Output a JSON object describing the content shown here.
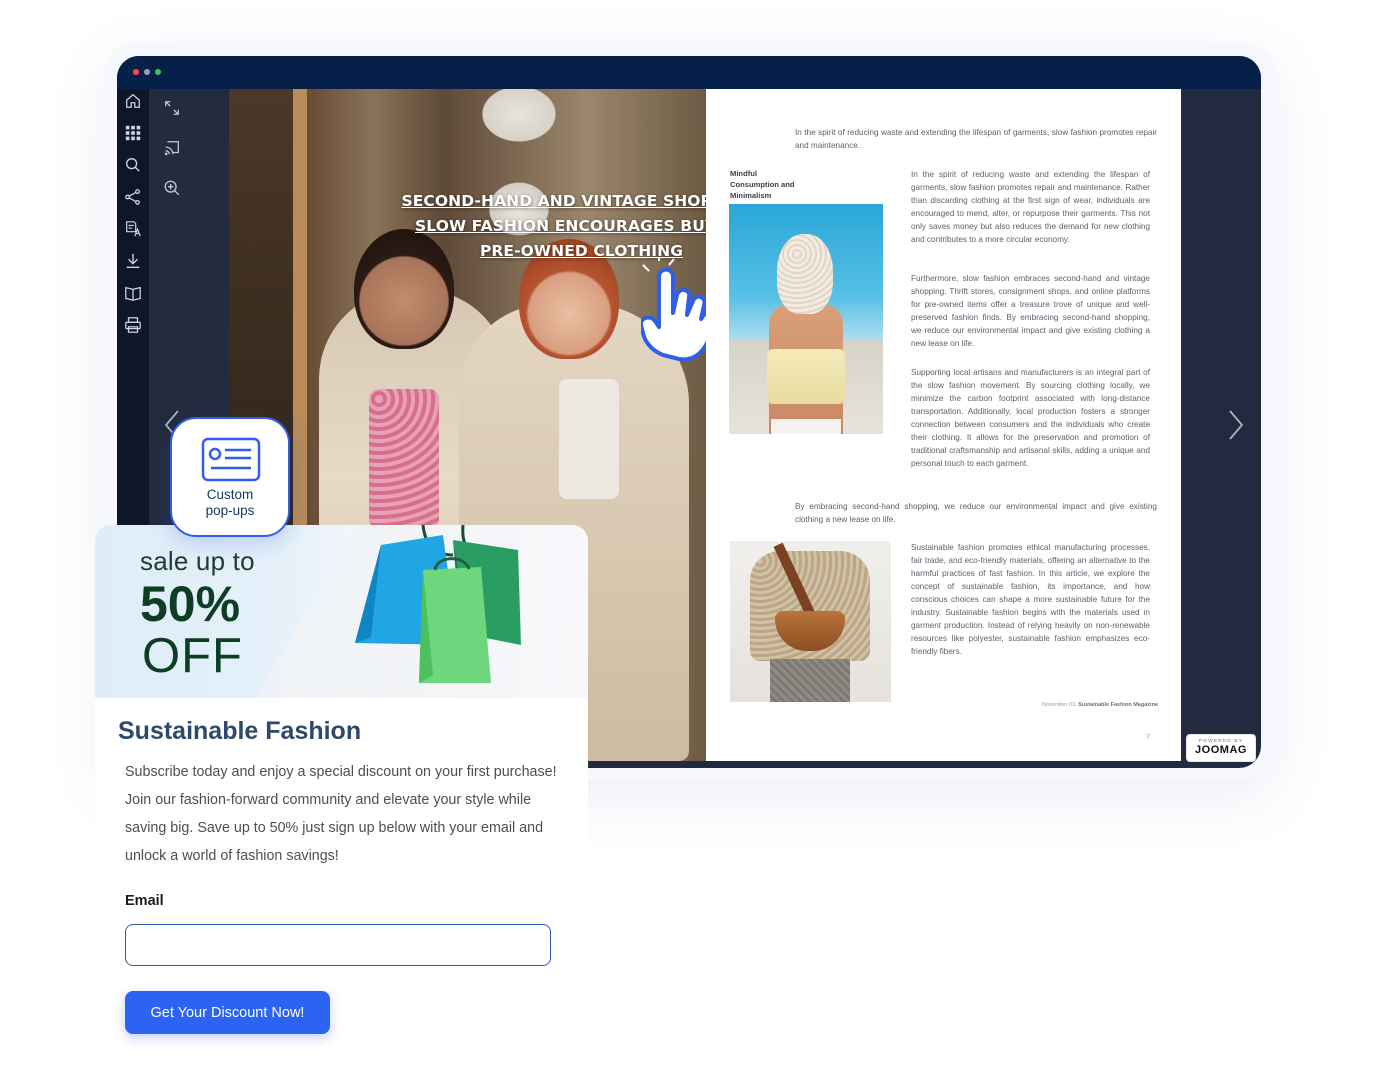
{
  "window": {
    "sidebar_icons": [
      "home-icon",
      "grid-icon",
      "search-icon",
      "share-icon",
      "translate-icon",
      "download-icon",
      "book-icon",
      "print-icon"
    ],
    "tool_icons": [
      "expand-icon",
      "cast-icon",
      "zoom-in-icon"
    ]
  },
  "left_page": {
    "headline_line1": "SECOND-HAND AND VINTAGE SHOPPING:",
    "headline_line2": "SLOW FASHION ENCOURAGES BUYING",
    "headline_line3": "PRE-OWNED CLOTHING"
  },
  "right_page": {
    "intro": "In the spirit of reducing waste and extending the lifespan of garments, slow fashion promotes repair and maintenance.",
    "side_heading_line1": "Mindful",
    "side_heading_line2": "Consumption and",
    "side_heading_line3": "Minimalism",
    "para1": "In the spirit of reducing waste and extending the lifespan of garments, slow fashion promotes repair and maintenance. Rather than discarding clothing at the first sign of wear, individuals are encouraged to mend, alter, or repurpose their garments. This not only saves money but also reduces the demand for new clothing and contributes to a more circular economy.",
    "para2": "Furthermore, slow fashion embraces second-hand and vintage shopping. Thrift stores, consignment shops, and online platforms for pre-owned items offer a treasure trove of unique and well-preserved fashion finds. By embracing second-hand shopping, we reduce our environmental impact and give existing clothing a new lease on life.",
    "para3": "Supporting local artisans and manufacturers is an integral part of the slow fashion movement. By sourcing clothing locally, we minimize the carbon footprint associated with long-distance transportation. Additionally, local production fosters a stronger connection between consumers and the individuals who create their clothing. It allows for the preservation and promotion of traditional craftsmanship and artisanal skills, adding a unique and personal touch to each garment.",
    "mid": "By embracing second-hand shopping, we reduce our environmental impact and give existing clothing a new lease on life.",
    "para4": "Sustainable fashion promotes ethical manufacturing processes, fair trade, and eco-friendly materials, offering an alternative to the harmful practices of fast fashion. In this article, we explore the concept of sustainable fashion, its importance, and how conscious choices can shape a more sustainable future for the industry. Sustainable fashion begins with the materials used in garment production. Instead of relying heavily on non-renewable resources like polyester, sustainable fashion emphasizes eco-friendly fibers.",
    "footer_date": "November 03,",
    "footer_mag": "Sustainable Fashion Magazine",
    "page_number": "7"
  },
  "joomag": {
    "powered_by": "POWERED BY",
    "name": "JOOMAG"
  },
  "badge": {
    "line1": "Custom",
    "line2": "pop-ups"
  },
  "popup": {
    "sale_up_to": "sale up to",
    "percent": "50%",
    "off": "OFF",
    "title": "Sustainable Fashion",
    "description": "Subscribe today and enjoy a special discount on your first purchase! Join our fashion-forward community and elevate your style while saving big. Save up to 50% just sign up below with your email and unlock a world of fashion savings!",
    "email_label": "Email",
    "email_value": "",
    "email_placeholder": "",
    "cta_label": "Get Your Discount Now!"
  },
  "colors": {
    "titlebar": "#06204a",
    "accent_blue": "#2b63f3",
    "sale_green": "#0d3d22",
    "title_blue": "#2e4a6a"
  }
}
